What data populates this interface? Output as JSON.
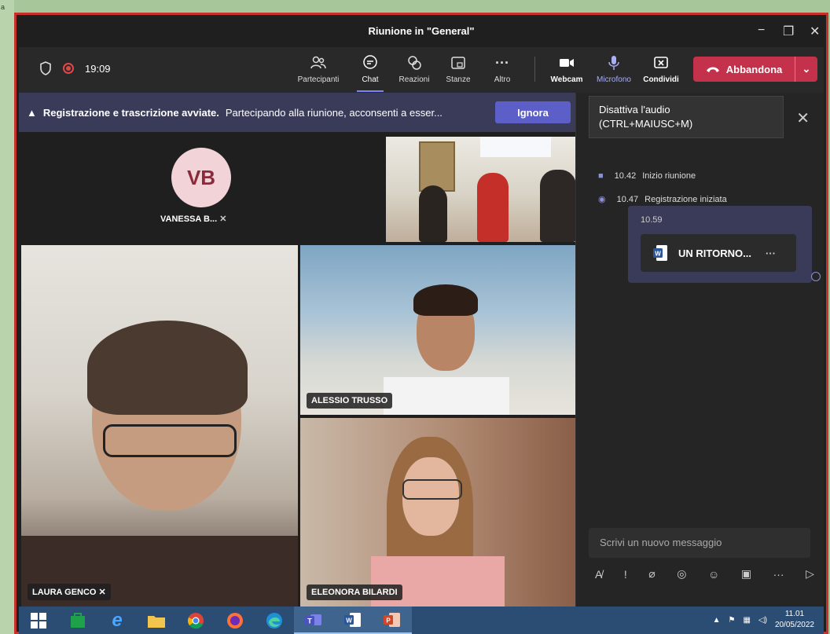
{
  "outer": {
    "corner_text": "a"
  },
  "window": {
    "title": "Riunione in \"General\"",
    "minimize": "−",
    "restore": "❐",
    "close": "✕"
  },
  "toolbar": {
    "timer": "19:09",
    "buttons": [
      {
        "label": "Partecipanti",
        "icon": "participants-icon"
      },
      {
        "label": "Chat",
        "icon": "chat-icon"
      },
      {
        "label": "Reazioni",
        "icon": "reactions-icon"
      },
      {
        "label": "Stanze",
        "icon": "rooms-icon"
      },
      {
        "label": "Altro",
        "icon": "more-icon"
      },
      {
        "label": "Webcam",
        "icon": "camera-icon"
      },
      {
        "label": "Microfono",
        "icon": "mic-icon"
      },
      {
        "label": "Condividi",
        "icon": "share-icon"
      }
    ],
    "leave_label": "Abbandona"
  },
  "banner": {
    "bold": "Registrazione e trascrizione avviate.",
    "text": "Partecipando alla riunione, acconsenti a esser...",
    "ignore": "Ignora"
  },
  "participants": {
    "vb_initials": "VB",
    "vb_name": "VANESSA B...",
    "laura": "LAURA GENCO",
    "alessio": "ALESSIO TRUSSO",
    "eleonora": "ELEONORA BILARDI"
  },
  "panel": {
    "tooltip_line1": "Disattiva l'audio",
    "tooltip_line2": "(CTRL+MAIUSC+M)",
    "events": [
      {
        "time": "10.42",
        "text": "Inizio riunione"
      },
      {
        "time": "10.47",
        "text": "Registrazione iniziata"
      }
    ],
    "message_time": "10.59",
    "file_name": "UN RITORNO...",
    "file_more": "···",
    "compose_placeholder": "Scrivi un nuovo messaggio"
  },
  "taskbar": {
    "time": "11.01",
    "date": "20/05/2022"
  },
  "colors": {
    "accent": "#5b5fc7",
    "leave": "#c4314b",
    "frame": "#c8302b"
  }
}
